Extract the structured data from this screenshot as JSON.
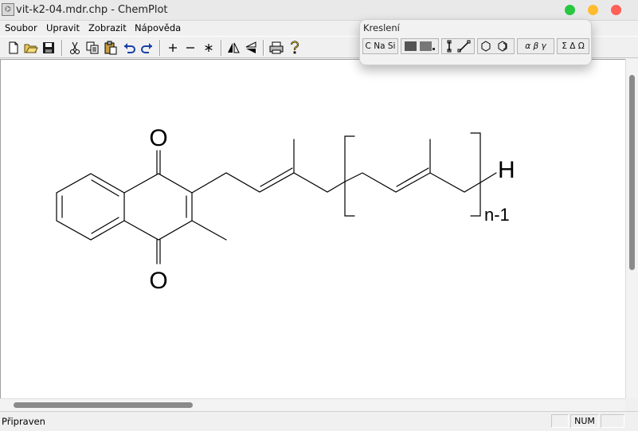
{
  "window": {
    "title": "vit-k2-04.mdr.chp - ChemPlot",
    "controls": {
      "green": "#28c840",
      "yellow": "#febc2e",
      "red": "#ff5f57"
    }
  },
  "menu": {
    "items": [
      "Soubor",
      "Upravit",
      "Zobrazit",
      "Nápověda"
    ]
  },
  "toolbar": {
    "buttons": [
      "new-file-icon",
      "open-folder-icon",
      "save-icon",
      "cut-icon",
      "copy-icon",
      "paste-icon",
      "undo-icon",
      "redo-icon",
      "zoom-in-icon",
      "zoom-out-icon",
      "asterisk-icon",
      "flip-horizontal-icon",
      "flip-vertical-icon",
      "print-icon",
      "help-icon"
    ]
  },
  "palette": {
    "title": "Kreslení",
    "elements_label": "C Na Si",
    "greek_label": "α β γ",
    "symbols_label": "Σ Δ Ω"
  },
  "drawing": {
    "atom_o_top": "O",
    "atom_o_bottom": "O",
    "end_group": "H",
    "repeat_subscript": "n-1",
    "structure": "vitamin K2 menaquinone"
  },
  "status": {
    "text": "Připraven",
    "num": "NUM"
  }
}
